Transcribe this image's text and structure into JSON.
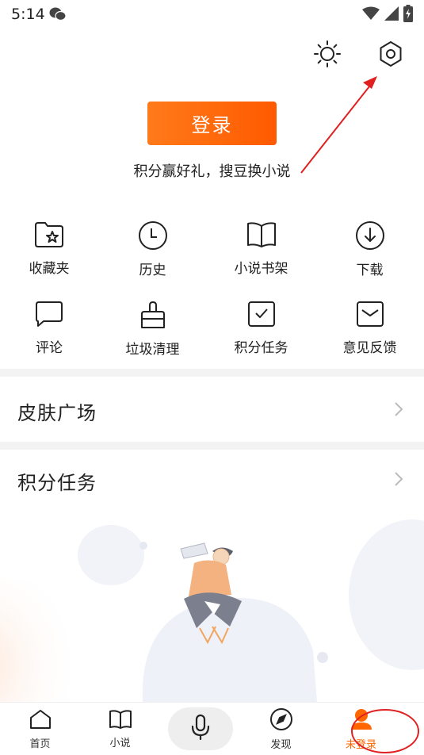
{
  "status_bar": {
    "time": "5:14"
  },
  "header": {
    "brightness_icon": "sun-icon",
    "settings_icon": "gear-icon"
  },
  "login": {
    "button_label": "登录",
    "subtitle": "积分赢好礼，搜豆换小说"
  },
  "grid": {
    "row1": [
      {
        "label": "收藏夹",
        "icon": "folder-star-icon"
      },
      {
        "label": "历史",
        "icon": "clock-icon"
      },
      {
        "label": "小说书架",
        "icon": "book-icon"
      },
      {
        "label": "下载",
        "icon": "download-icon"
      }
    ],
    "row2": [
      {
        "label": "评论",
        "icon": "comment-icon"
      },
      {
        "label": "垃圾清理",
        "icon": "broom-icon"
      },
      {
        "label": "积分任务",
        "icon": "task-check-icon"
      },
      {
        "label": "意见反馈",
        "icon": "mail-icon"
      }
    ]
  },
  "sections": {
    "skin": "皮肤广场",
    "tasks": "积分任务"
  },
  "bottom_nav": {
    "home": "首页",
    "novel": "小说",
    "discover": "发现",
    "me": "未登录"
  },
  "colors": {
    "accent": "#ff6600",
    "annotation_red": "#e02020"
  }
}
